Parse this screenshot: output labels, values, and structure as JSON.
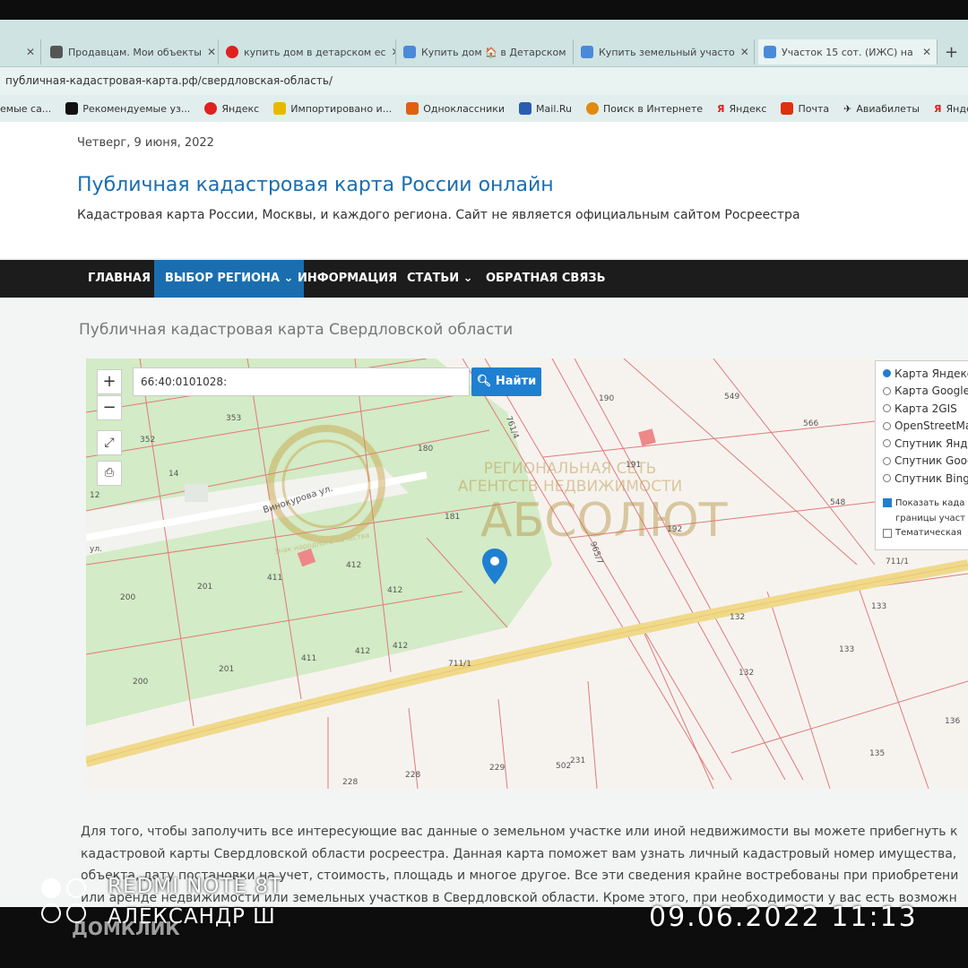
{
  "tabs": [
    {
      "label": "",
      "active": false
    },
    {
      "label": "Продавцам. Мои объекты",
      "active": false
    },
    {
      "label": "купить дом в детарском ес",
      "active": false
    },
    {
      "label": "Купить дом 🏠 в Детарском",
      "active": false
    },
    {
      "label": "Купить земельный участо",
      "active": false
    },
    {
      "label": "Участок 15 сот. (ИЖС) на",
      "active": true
    }
  ],
  "address": "публичная-кадастровая-карта.рф/свердловская-область/",
  "bookmarks": [
    "емые са...",
    "Рекомендуемые уз...",
    "Яндекс",
    "Импортировано и...",
    "Одноклассники",
    "Mail.Ru",
    "Поиск в Интернете",
    "Яндекс",
    "Почта",
    "Авиабилеты",
    "Яндекс"
  ],
  "header": {
    "date": "Четверг, 9 июня, 2022",
    "title": "Публичная кадастровая карта России онлайн",
    "subtitle": "Кадастровая карта России, Москвы, и каждого региона. Сайт не является официальным сайтом Росреестра"
  },
  "nav": [
    "ГЛАВНАЯ",
    "ВЫБОР РЕГИОНА ⌄",
    "ИНФОРМАЦИЯ",
    "СТАТЬИ ⌄",
    "ОБРАТНАЯ СВЯЗЬ"
  ],
  "page_heading": "Публичная кадастровая карта Свердловской области",
  "map": {
    "zoom_in": "+",
    "zoom_out": "−",
    "search_value": "66:40:0101028:",
    "search_button": "Найти",
    "layers": [
      "Карта Яндекс",
      "Карта Google",
      "Карта 2GIS",
      "OpenStreetMap",
      "Спутник Яндекс",
      "Спутник Google",
      "Спутник Bing"
    ],
    "checkbox1": "Показать када",
    "checkbox1b": "границы участ",
    "checkbox2": "Тематическая",
    "watermark_line1": "РЕГИОНАЛЬНАЯ СЕТЬ",
    "watermark_line2": "АГЕНТСТВ НЕДВИЖИМОСТИ",
    "watermark_brand": "АБСОЛЮТ",
    "watermark_small": "Знак народного качества",
    "labels": [
      "190",
      "549",
      "566",
      "353",
      "352",
      "14",
      "12",
      "180",
      "191",
      "181",
      "192",
      "548",
      "711/1",
      "411",
      "412",
      "412",
      "201",
      "200",
      "412",
      "411",
      "201",
      "200",
      "412",
      "711/1",
      "133",
      "132",
      "133",
      "132",
      "136",
      "135",
      "228",
      "228",
      "229",
      "502",
      "231",
      "Винокурова ул.",
      "ул.",
      "761/4",
      "965/7"
    ]
  },
  "paragraph": [
    "Для того, чтобы заполучить все интересующие вас данные о земельном участке или иной недвижимости вы можете прибегнуть к",
    "кадастровой карты Свердловской области росреестра. Данная карта поможет вам узнать личный кадастровый номер имущества,",
    "объекта, дату постановки на учет, стоимость, площадь и многое другое. Все эти сведения крайне востребованы при приобретени",
    "или аренде недвижимости или земельных участков в Свердловской области. Кроме этого, при необходимости у вас есть возможн"
  ],
  "photo_overlay": {
    "device": "REDMI NOTE 8T",
    "author": "АЛЕКСАНДР Ш",
    "timestamp": "09.06.2022 11:13",
    "brand": "ДОМКЛИК"
  },
  "colors": {
    "accent": "#1a6eb0",
    "nav_bg": "#1c1c1c",
    "road": "#f0d98a",
    "parcel_line": "#e07070",
    "green": "#cfe8c0"
  }
}
